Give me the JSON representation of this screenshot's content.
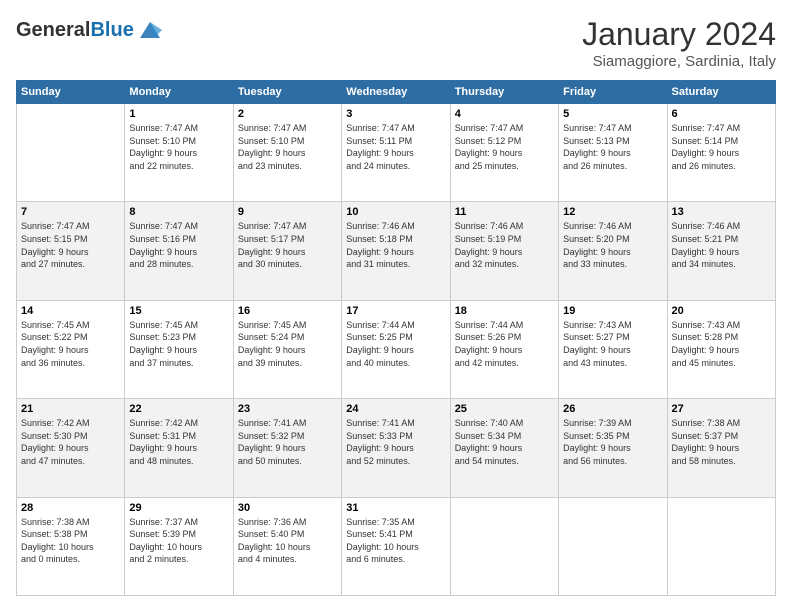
{
  "logo": {
    "general": "General",
    "blue": "Blue"
  },
  "title": {
    "month": "January 2024",
    "location": "Siamaggiore, Sardinia, Italy"
  },
  "weekdays": [
    "Sunday",
    "Monday",
    "Tuesday",
    "Wednesday",
    "Thursday",
    "Friday",
    "Saturday"
  ],
  "weeks": [
    [
      {
        "day": "",
        "info": ""
      },
      {
        "day": "1",
        "info": "Sunrise: 7:47 AM\nSunset: 5:10 PM\nDaylight: 9 hours\nand 22 minutes."
      },
      {
        "day": "2",
        "info": "Sunrise: 7:47 AM\nSunset: 5:10 PM\nDaylight: 9 hours\nand 23 minutes."
      },
      {
        "day": "3",
        "info": "Sunrise: 7:47 AM\nSunset: 5:11 PM\nDaylight: 9 hours\nand 24 minutes."
      },
      {
        "day": "4",
        "info": "Sunrise: 7:47 AM\nSunset: 5:12 PM\nDaylight: 9 hours\nand 25 minutes."
      },
      {
        "day": "5",
        "info": "Sunrise: 7:47 AM\nSunset: 5:13 PM\nDaylight: 9 hours\nand 26 minutes."
      },
      {
        "day": "6",
        "info": "Sunrise: 7:47 AM\nSunset: 5:14 PM\nDaylight: 9 hours\nand 26 minutes."
      }
    ],
    [
      {
        "day": "7",
        "info": "Sunrise: 7:47 AM\nSunset: 5:15 PM\nDaylight: 9 hours\nand 27 minutes."
      },
      {
        "day": "8",
        "info": "Sunrise: 7:47 AM\nSunset: 5:16 PM\nDaylight: 9 hours\nand 28 minutes."
      },
      {
        "day": "9",
        "info": "Sunrise: 7:47 AM\nSunset: 5:17 PM\nDaylight: 9 hours\nand 30 minutes."
      },
      {
        "day": "10",
        "info": "Sunrise: 7:46 AM\nSunset: 5:18 PM\nDaylight: 9 hours\nand 31 minutes."
      },
      {
        "day": "11",
        "info": "Sunrise: 7:46 AM\nSunset: 5:19 PM\nDaylight: 9 hours\nand 32 minutes."
      },
      {
        "day": "12",
        "info": "Sunrise: 7:46 AM\nSunset: 5:20 PM\nDaylight: 9 hours\nand 33 minutes."
      },
      {
        "day": "13",
        "info": "Sunrise: 7:46 AM\nSunset: 5:21 PM\nDaylight: 9 hours\nand 34 minutes."
      }
    ],
    [
      {
        "day": "14",
        "info": "Sunrise: 7:45 AM\nSunset: 5:22 PM\nDaylight: 9 hours\nand 36 minutes."
      },
      {
        "day": "15",
        "info": "Sunrise: 7:45 AM\nSunset: 5:23 PM\nDaylight: 9 hours\nand 37 minutes."
      },
      {
        "day": "16",
        "info": "Sunrise: 7:45 AM\nSunset: 5:24 PM\nDaylight: 9 hours\nand 39 minutes."
      },
      {
        "day": "17",
        "info": "Sunrise: 7:44 AM\nSunset: 5:25 PM\nDaylight: 9 hours\nand 40 minutes."
      },
      {
        "day": "18",
        "info": "Sunrise: 7:44 AM\nSunset: 5:26 PM\nDaylight: 9 hours\nand 42 minutes."
      },
      {
        "day": "19",
        "info": "Sunrise: 7:43 AM\nSunset: 5:27 PM\nDaylight: 9 hours\nand 43 minutes."
      },
      {
        "day": "20",
        "info": "Sunrise: 7:43 AM\nSunset: 5:28 PM\nDaylight: 9 hours\nand 45 minutes."
      }
    ],
    [
      {
        "day": "21",
        "info": "Sunrise: 7:42 AM\nSunset: 5:30 PM\nDaylight: 9 hours\nand 47 minutes."
      },
      {
        "day": "22",
        "info": "Sunrise: 7:42 AM\nSunset: 5:31 PM\nDaylight: 9 hours\nand 48 minutes."
      },
      {
        "day": "23",
        "info": "Sunrise: 7:41 AM\nSunset: 5:32 PM\nDaylight: 9 hours\nand 50 minutes."
      },
      {
        "day": "24",
        "info": "Sunrise: 7:41 AM\nSunset: 5:33 PM\nDaylight: 9 hours\nand 52 minutes."
      },
      {
        "day": "25",
        "info": "Sunrise: 7:40 AM\nSunset: 5:34 PM\nDaylight: 9 hours\nand 54 minutes."
      },
      {
        "day": "26",
        "info": "Sunrise: 7:39 AM\nSunset: 5:35 PM\nDaylight: 9 hours\nand 56 minutes."
      },
      {
        "day": "27",
        "info": "Sunrise: 7:38 AM\nSunset: 5:37 PM\nDaylight: 9 hours\nand 58 minutes."
      }
    ],
    [
      {
        "day": "28",
        "info": "Sunrise: 7:38 AM\nSunset: 5:38 PM\nDaylight: 10 hours\nand 0 minutes."
      },
      {
        "day": "29",
        "info": "Sunrise: 7:37 AM\nSunset: 5:39 PM\nDaylight: 10 hours\nand 2 minutes."
      },
      {
        "day": "30",
        "info": "Sunrise: 7:36 AM\nSunset: 5:40 PM\nDaylight: 10 hours\nand 4 minutes."
      },
      {
        "day": "31",
        "info": "Sunrise: 7:35 AM\nSunset: 5:41 PM\nDaylight: 10 hours\nand 6 minutes."
      },
      {
        "day": "",
        "info": ""
      },
      {
        "day": "",
        "info": ""
      },
      {
        "day": "",
        "info": ""
      }
    ]
  ]
}
